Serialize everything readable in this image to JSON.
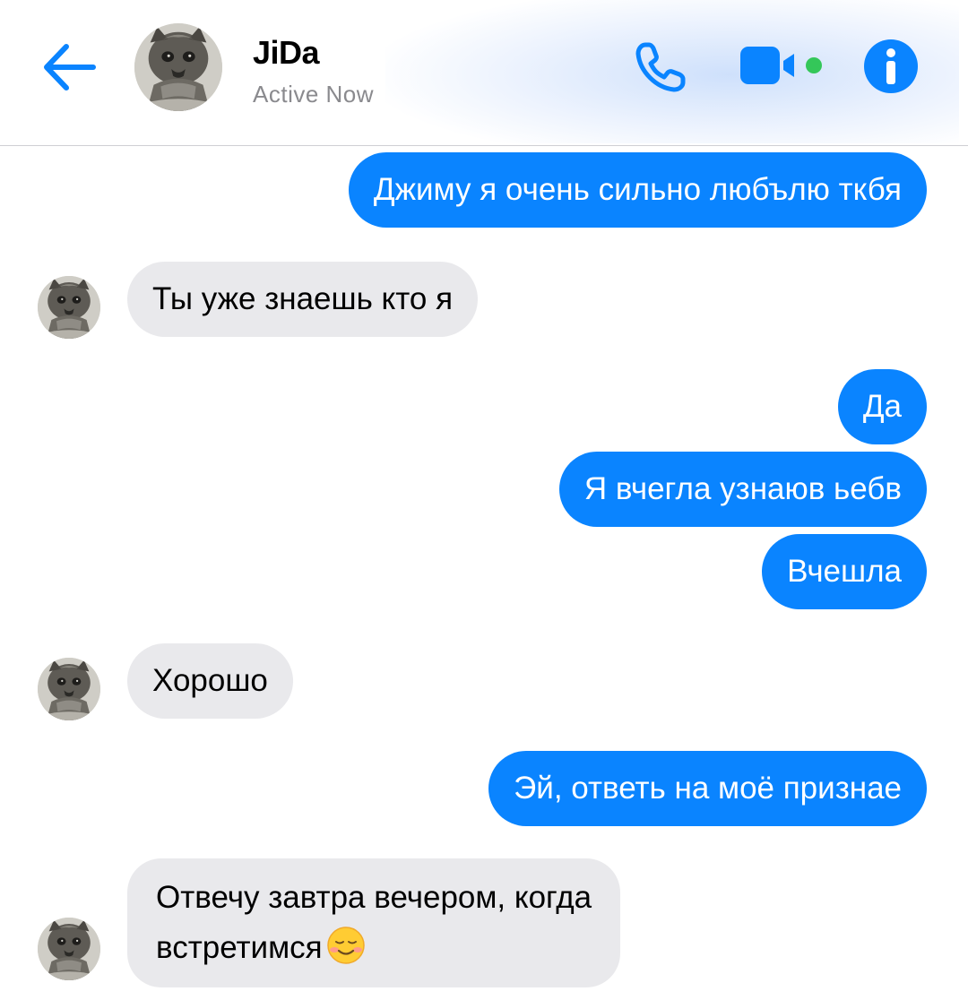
{
  "header": {
    "name": "JiDa",
    "status": "Active Now"
  },
  "colors": {
    "accent": "#0a84ff",
    "incoming_bubble": "#e9e9ec",
    "online": "#34c759"
  },
  "icons": {
    "back": "arrow-left-icon",
    "call": "phone-icon",
    "video": "video-camera-icon",
    "info": "info-icon",
    "emoji": "smiling-face-emoji"
  },
  "messages": [
    {
      "from": "me",
      "text": "Джиму я очень сильно любълю ткбя"
    },
    {
      "from": "them",
      "text": "Ты уже знаешь кто я"
    },
    {
      "from": "me",
      "text": "Да"
    },
    {
      "from": "me",
      "text": "Я вчегла узнаюв ьебв"
    },
    {
      "from": "me",
      "text": "Вчешла"
    },
    {
      "from": "them",
      "text": "Хорошо"
    },
    {
      "from": "me",
      "text": "Эй, ответь на моё признае"
    },
    {
      "from": "them",
      "text_line1": "Отвечу завтра вечером, когда",
      "text_line2": "встретимся"
    }
  ]
}
